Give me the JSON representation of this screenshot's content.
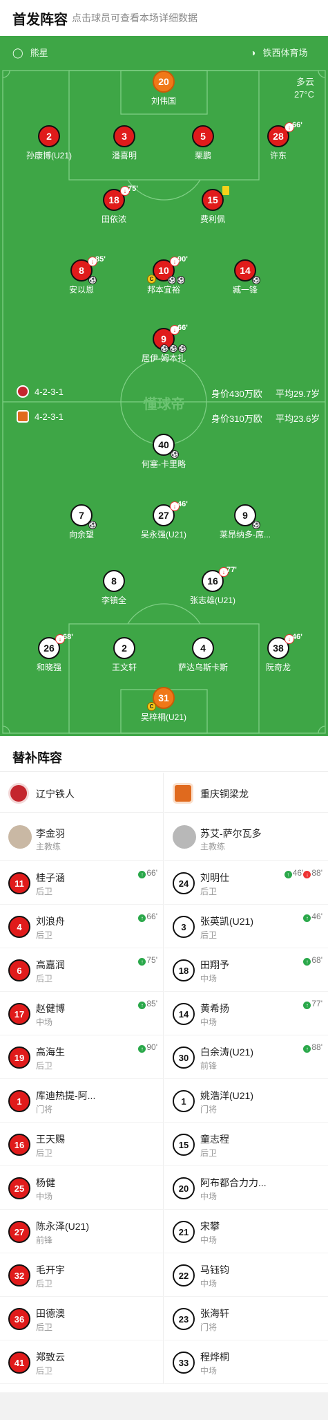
{
  "header": {
    "title": "首发阵容",
    "subtitle": "点击球员可查看本场详细数据"
  },
  "pitch": {
    "home_name": "熊星",
    "venue": "铁西体育场",
    "weather": "多云",
    "temperature": "27°C",
    "watermark": "懂球帝"
  },
  "teams": {
    "top": {
      "formation": "4-2-3-1",
      "value": "身价430万欧",
      "avg_age": "平均29.7岁"
    },
    "bottom": {
      "formation": "4-2-3-1",
      "value": "身价310万欧",
      "avg_age": "平均23.6岁"
    }
  },
  "lineup_top": [
    {
      "num": "20",
      "name": "刘伟国",
      "pos": "gk"
    },
    {
      "num": "2",
      "name": "孙康博(U21)"
    },
    {
      "num": "3",
      "name": "潘喜明"
    },
    {
      "num": "5",
      "name": "栗鹏"
    },
    {
      "num": "28",
      "name": "许东",
      "sub": "66'"
    },
    {
      "num": "18",
      "name": "田依浓",
      "sub": "75'"
    },
    {
      "num": "15",
      "name": "费利佩"
    },
    {
      "num": "8",
      "name": "安以恩",
      "sub": "85'"
    },
    {
      "num": "10",
      "name": "邦本宜裕",
      "sub": "90'"
    },
    {
      "num": "14",
      "name": "臧一锋"
    },
    {
      "num": "9",
      "name": "居伊-姆本扎",
      "sub": "66'"
    }
  ],
  "lineup_bottom": [
    {
      "num": "40",
      "name": "何塞-卡里略"
    },
    {
      "num": "7",
      "name": "向余望"
    },
    {
      "num": "27",
      "name": "吴永强(U21)",
      "sub": "46'"
    },
    {
      "num": "9",
      "name": "莱昂纳多-席..."
    },
    {
      "num": "8",
      "name": "李镇全"
    },
    {
      "num": "16",
      "name": "张志雄(U21)",
      "sub": "77'"
    },
    {
      "num": "26",
      "name": "和晓强",
      "sub": "68'"
    },
    {
      "num": "2",
      "name": "王文轩"
    },
    {
      "num": "4",
      "name": "萨达乌斯卡斯"
    },
    {
      "num": "38",
      "name": "阮奇龙",
      "sub": "46'"
    },
    {
      "num": "31",
      "name": "吴梓桐(U21)",
      "pos": "gk"
    }
  ],
  "subs": {
    "title": "替补阵容",
    "left_team": "辽宁铁人",
    "right_team": "重庆铜梁龙",
    "left_coach": {
      "name": "李金羽",
      "role": "主教练"
    },
    "right_coach": {
      "name": "苏艾-萨尔瓦多",
      "role": "主教练"
    },
    "left": [
      {
        "num": "11",
        "name": "桂子涵",
        "pos": "后卫",
        "ev": "66'"
      },
      {
        "num": "4",
        "name": "刘浪舟",
        "pos": "后卫",
        "ev": "66'"
      },
      {
        "num": "6",
        "name": "高嘉润",
        "pos": "后卫",
        "ev": "75'"
      },
      {
        "num": "17",
        "name": "赵健博",
        "pos": "中场",
        "ev": "85'"
      },
      {
        "num": "19",
        "name": "高海生",
        "pos": "后卫",
        "ev": "90'"
      },
      {
        "num": "1",
        "name": "库迪热提-阿...",
        "pos": "门将",
        "ev": ""
      },
      {
        "num": "16",
        "name": "王天赐",
        "pos": "后卫",
        "ev": ""
      },
      {
        "num": "25",
        "name": "杨健",
        "pos": "中场",
        "ev": ""
      },
      {
        "num": "27",
        "name": "陈永泽(U21)",
        "pos": "前锋",
        "ev": ""
      },
      {
        "num": "32",
        "name": "毛开宇",
        "pos": "后卫",
        "ev": ""
      },
      {
        "num": "36",
        "name": "田德澳",
        "pos": "后卫",
        "ev": ""
      },
      {
        "num": "41",
        "name": "郑致云",
        "pos": "后卫",
        "ev": ""
      }
    ],
    "right": [
      {
        "num": "24",
        "name": "刘明仕",
        "pos": "后卫",
        "ev": "46'",
        "ev2": "88'"
      },
      {
        "num": "3",
        "name": "张英凯(U21)",
        "pos": "后卫",
        "ev": "46'"
      },
      {
        "num": "18",
        "name": "田翔予",
        "pos": "中场",
        "ev": "68'"
      },
      {
        "num": "14",
        "name": "黄希扬",
        "pos": "中场",
        "ev": "77'"
      },
      {
        "num": "30",
        "name": "白余涛(U21)",
        "pos": "前锋",
        "ev": "88'"
      },
      {
        "num": "1",
        "name": "姚浩洋(U21)",
        "pos": "门将",
        "ev": ""
      },
      {
        "num": "15",
        "name": "童志程",
        "pos": "后卫",
        "ev": ""
      },
      {
        "num": "20",
        "name": "阿布都合力力...",
        "pos": "中场",
        "ev": ""
      },
      {
        "num": "21",
        "name": "宋攀",
        "pos": "中场",
        "ev": ""
      },
      {
        "num": "22",
        "name": "马钰钧",
        "pos": "中场",
        "ev": ""
      },
      {
        "num": "23",
        "name": "张海轩",
        "pos": "门将",
        "ev": ""
      },
      {
        "num": "33",
        "name": "程烨桐",
        "pos": "中场",
        "ev": ""
      }
    ]
  },
  "colors": {
    "pitch": "#3ea646",
    "home": "#e01b1b",
    "gk_home": "#f07818",
    "away": "#ffffff"
  }
}
